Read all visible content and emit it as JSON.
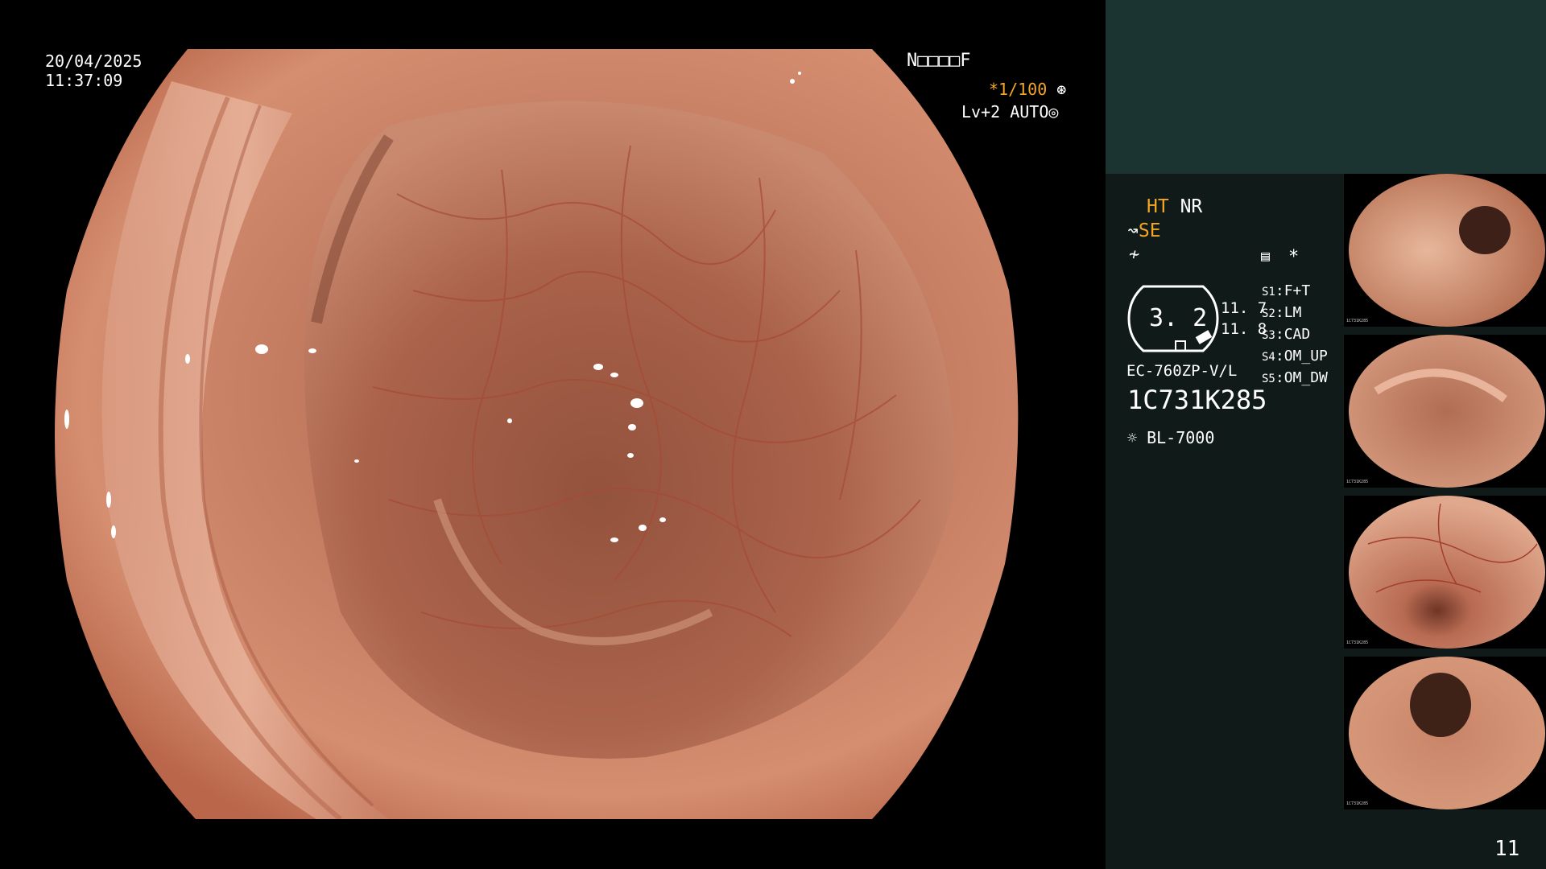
{
  "osd": {
    "date": "20/04/2025",
    "time": "11:37:09",
    "status_code": "N□□□□F",
    "shutter": "*1/100",
    "level": "Lv+2",
    "auto": "AUTO"
  },
  "panel": {
    "ht": "HT",
    "nr": "NR",
    "se": "SE",
    "zoom_value": "3. 2",
    "value_1": "11. 7",
    "value_2": "11. 8",
    "scope_model": "EC-760ZP-V/L",
    "serial": "1C731K285",
    "light_source": "BL-7000",
    "asterisk": "*",
    "settings": [
      {
        "key": "S1",
        "value": "F+T"
      },
      {
        "key": "S2",
        "value": "LM"
      },
      {
        "key": "S3",
        "value": "CAD"
      },
      {
        "key": "S4",
        "value": "OM_UP"
      },
      {
        "key": "S5",
        "value": "OM_DW"
      }
    ],
    "thumb_serial": "1C731K285",
    "page_number": "11"
  },
  "colors": {
    "panel_top": "#1b3431",
    "panel_bg": "#0f1a19",
    "accent_orange": "#f5a623",
    "mucosa": "#c8785f"
  },
  "icons": [
    "iris-icon",
    "auto-exposure-icon",
    "structure-enhance-icon",
    "freeze-icon",
    "image-settings-icon",
    "zoom-gauge-icon",
    "light-source-icon"
  ]
}
